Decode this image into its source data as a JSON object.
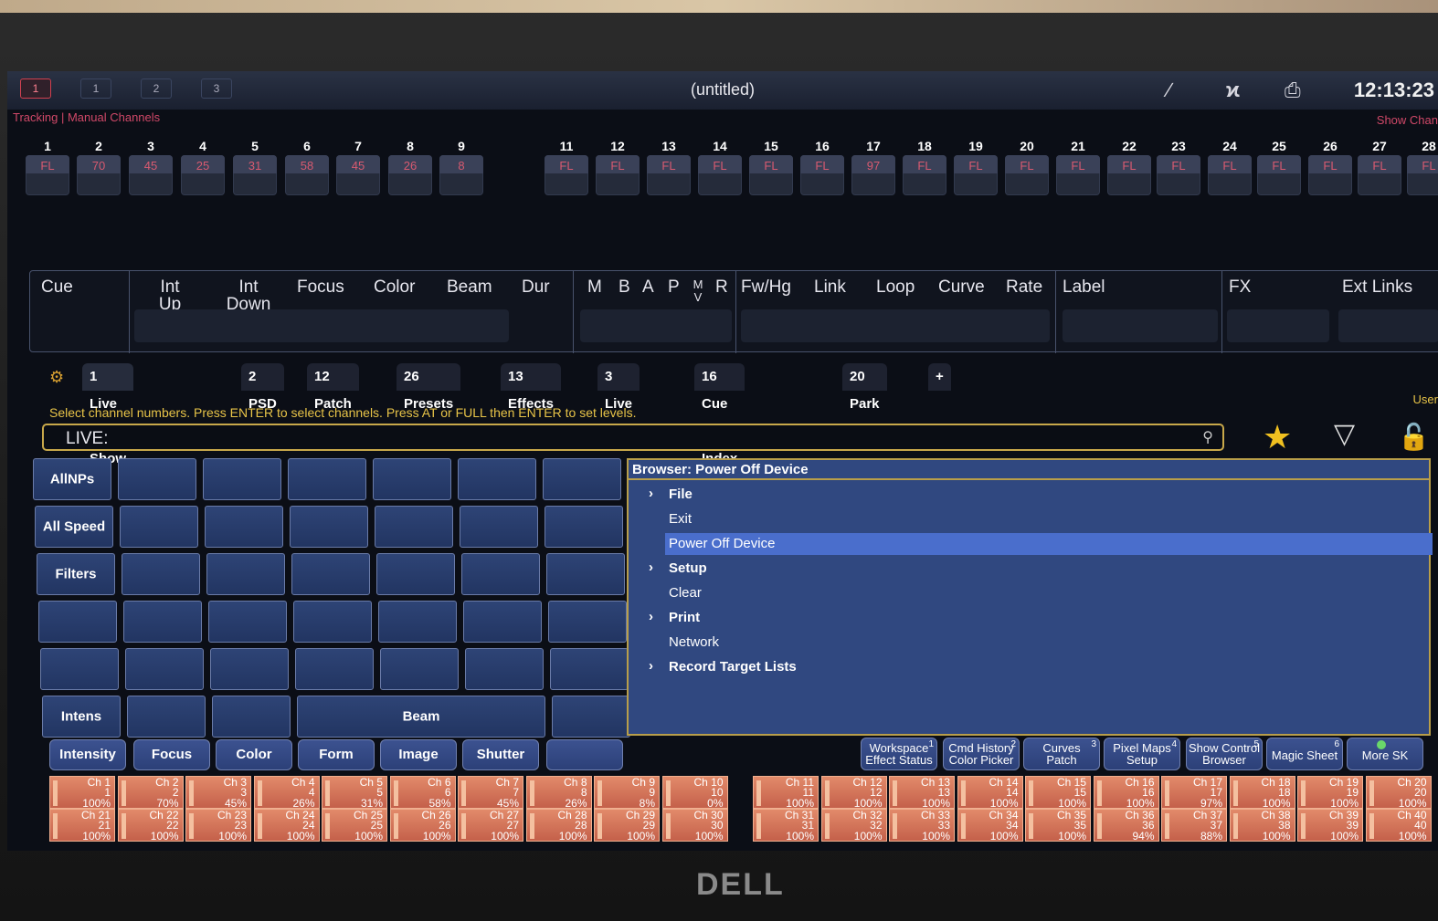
{
  "topbar": {
    "workspaces": [
      "1",
      "1",
      "2",
      "3"
    ],
    "title": "(untitled)",
    "clock": "12:13:23",
    "status_left": "Tracking | Manual Channels",
    "status_right": "Show Chan"
  },
  "channels": [
    {
      "n": "1",
      "v": "FL"
    },
    {
      "n": "2",
      "v": "70"
    },
    {
      "n": "3",
      "v": "45"
    },
    {
      "n": "4",
      "v": "25"
    },
    {
      "n": "5",
      "v": "31"
    },
    {
      "n": "6",
      "v": "58"
    },
    {
      "n": "7",
      "v": "45"
    },
    {
      "n": "8",
      "v": "26"
    },
    {
      "n": "9",
      "v": "8"
    },
    {
      "n": "11",
      "v": "FL"
    },
    {
      "n": "12",
      "v": "FL"
    },
    {
      "n": "13",
      "v": "FL"
    },
    {
      "n": "14",
      "v": "FL"
    },
    {
      "n": "15",
      "v": "FL"
    },
    {
      "n": "16",
      "v": "FL"
    },
    {
      "n": "17",
      "v": "97"
    },
    {
      "n": "18",
      "v": "FL"
    },
    {
      "n": "19",
      "v": "FL"
    },
    {
      "n": "20",
      "v": "FL"
    },
    {
      "n": "21",
      "v": "FL"
    },
    {
      "n": "22",
      "v": "FL"
    },
    {
      "n": "23",
      "v": "FL"
    },
    {
      "n": "24",
      "v": "FL"
    },
    {
      "n": "25",
      "v": "FL"
    },
    {
      "n": "26",
      "v": "FL"
    },
    {
      "n": "27",
      "v": "FL"
    },
    {
      "n": "28",
      "v": "FL"
    }
  ],
  "cue_header": {
    "cue": "Cue",
    "int_up": "Int Up",
    "int_down": "Int Down",
    "focus": "Focus",
    "color": "Color",
    "beam": "Beam",
    "dur": "Dur",
    "m": "M",
    "b": "B",
    "a": "A",
    "p": "P",
    "mv": "M V",
    "r": "R",
    "fwhg": "Fw/Hg",
    "link": "Link",
    "loop": "Loop",
    "curve": "Curve",
    "rate": "Rate",
    "label": "Label",
    "fx": "FX",
    "ext_links": "Ext Links"
  },
  "tabs": [
    "1 Live Table Show",
    "2 PSD",
    "12 Patch",
    "26 Presets",
    "13 Effects",
    "3 Live MS",
    "16 Cue List Index",
    "20 Park",
    "+"
  ],
  "hint": "Select channel numbers.  Press ENTER to select channels.  Press AT or FULL then ENTER to set levels.",
  "user_label": "User",
  "command_line": {
    "label": "LIVE:"
  },
  "grid_buttons": {
    "allnps": "AllNPs",
    "all_speed": "All Speed",
    "filters": "Filters",
    "intens": "Intens",
    "beam": "Beam"
  },
  "categories": [
    "Intensity",
    "Focus",
    "Color",
    "Form",
    "Image",
    "Shutter"
  ],
  "browser": {
    "title": "Browser: Power Off Device",
    "items": [
      {
        "label": "File",
        "bold": true,
        "expand": true
      },
      {
        "label": "Exit",
        "bold": false,
        "expand": false
      },
      {
        "label": "Power Off Device",
        "bold": false,
        "expand": false,
        "selected": true
      },
      {
        "label": "Setup",
        "bold": true,
        "expand": true
      },
      {
        "label": "Clear",
        "bold": false,
        "expand": false
      },
      {
        "label": "Print",
        "bold": true,
        "expand": true
      },
      {
        "label": "Network",
        "bold": false,
        "expand": false
      },
      {
        "label": "Record Target Lists",
        "bold": true,
        "expand": true
      }
    ]
  },
  "softkeys": [
    {
      "l1": "Workspace",
      "l2": "Effect Status",
      "sup": "1"
    },
    {
      "l1": "Cmd History",
      "l2": "Color Picker",
      "sup": "2"
    },
    {
      "l1": "Curves",
      "l2": "Patch",
      "sup": "3"
    },
    {
      "l1": "Pixel Maps",
      "l2": "Setup",
      "sup": "4"
    },
    {
      "l1": "Show Control",
      "l2": "Browser",
      "sup": "5"
    },
    {
      "l1": "Magic Sheet",
      "l2": "",
      "sup": "6"
    },
    {
      "l1": "More SK",
      "l2": "",
      "sup": ""
    }
  ],
  "faders_top": [
    {
      "t": "Ch 1",
      "n": "1",
      "p": "100%"
    },
    {
      "t": "Ch 2",
      "n": "2",
      "p": "70%"
    },
    {
      "t": "Ch 3",
      "n": "3",
      "p": "45%"
    },
    {
      "t": "Ch 4",
      "n": "4",
      "p": "26%"
    },
    {
      "t": "Ch 5",
      "n": "5",
      "p": "31%"
    },
    {
      "t": "Ch 6",
      "n": "6",
      "p": "58%"
    },
    {
      "t": "Ch 7",
      "n": "7",
      "p": "45%"
    },
    {
      "t": "Ch 8",
      "n": "8",
      "p": "26%"
    },
    {
      "t": "Ch 9",
      "n": "9",
      "p": "8%"
    },
    {
      "t": "Ch 10",
      "n": "10",
      "p": "0%"
    },
    {
      "t": "Ch 11",
      "n": "11",
      "p": "100%"
    },
    {
      "t": "Ch 12",
      "n": "12",
      "p": "100%"
    },
    {
      "t": "Ch 13",
      "n": "13",
      "p": "100%"
    },
    {
      "t": "Ch 14",
      "n": "14",
      "p": "100%"
    },
    {
      "t": "Ch 15",
      "n": "15",
      "p": "100%"
    },
    {
      "t": "Ch 16",
      "n": "16",
      "p": "100%"
    },
    {
      "t": "Ch 17",
      "n": "17",
      "p": "97%"
    },
    {
      "t": "Ch 18",
      "n": "18",
      "p": "100%"
    },
    {
      "t": "Ch 19",
      "n": "19",
      "p": "100%"
    },
    {
      "t": "Ch 20",
      "n": "20",
      "p": "100%"
    }
  ],
  "faders_bottom": [
    {
      "t": "Ch 21",
      "n": "21",
      "p": "100%"
    },
    {
      "t": "Ch 22",
      "n": "22",
      "p": "100%"
    },
    {
      "t": "Ch 23",
      "n": "23",
      "p": "100%"
    },
    {
      "t": "Ch 24",
      "n": "24",
      "p": "100%"
    },
    {
      "t": "Ch 25",
      "n": "25",
      "p": "100%"
    },
    {
      "t": "Ch 26",
      "n": "26",
      "p": "100%"
    },
    {
      "t": "Ch 27",
      "n": "27",
      "p": "100%"
    },
    {
      "t": "Ch 28",
      "n": "28",
      "p": "100%"
    },
    {
      "t": "Ch 29",
      "n": "29",
      "p": "100%"
    },
    {
      "t": "Ch 30",
      "n": "30",
      "p": "100%"
    },
    {
      "t": "Ch 31",
      "n": "31",
      "p": "100%"
    },
    {
      "t": "Ch 32",
      "n": "32",
      "p": "100%"
    },
    {
      "t": "Ch 33",
      "n": "33",
      "p": "100%"
    },
    {
      "t": "Ch 34",
      "n": "34",
      "p": "100%"
    },
    {
      "t": "Ch 35",
      "n": "35",
      "p": "100%"
    },
    {
      "t": "Ch 36",
      "n": "36",
      "p": "94%"
    },
    {
      "t": "Ch 37",
      "n": "37",
      "p": "88%"
    },
    {
      "t": "Ch 38",
      "n": "38",
      "p": "100%"
    },
    {
      "t": "Ch 39",
      "n": "39",
      "p": "100%"
    },
    {
      "t": "Ch 40",
      "n": "40",
      "p": "100%"
    }
  ],
  "monitor_brand": "DELL",
  "colors": {
    "accent_gold": "#c8a84a",
    "level_red": "#d85a70",
    "button_blue": "#2e4476",
    "fader_orange": "#d87558"
  }
}
